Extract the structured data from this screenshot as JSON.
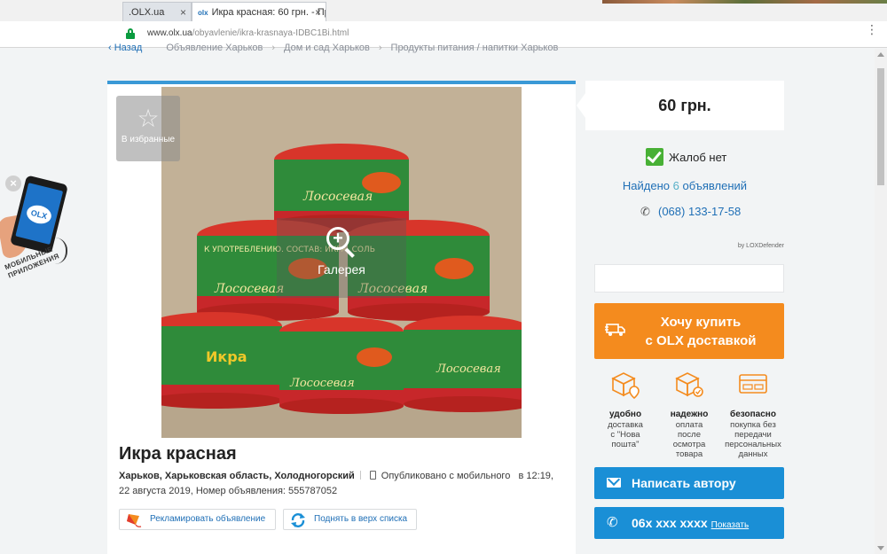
{
  "browser": {
    "tabs": [
      {
        "label": ".OLX.ua",
        "close": "×"
      },
      {
        "label": "Икра красная: 60 грн. - Пр",
        "close": "×",
        "favicon": "olx-favicon"
      }
    ],
    "url_host": "www.olx.ua",
    "url_path": "/obyavlenie/ikra-krasnaya-IDBC1Bi.html",
    "menu_icon": "⋮"
  },
  "breadcrumb": {
    "back": "Назад",
    "items": [
      "Объявление Харьков",
      "Дом и сад Харьков",
      "Продукты питания / напитки Харьков"
    ],
    "separator": "›"
  },
  "listing": {
    "favorite_label": "В избранные",
    "favorite_icon": "☆",
    "gallery_label": "Галерея",
    "title": "Икра красная",
    "location": "Харьков, Харьковская область, Холодногорский",
    "published": "Опубликовано с мобильного",
    "published_at": "в 12:19, 22 августа 2019, Номер объявления: 555787052",
    "promote_label": "Рекламировать объявление",
    "raise_label": "Поднять в верх списка",
    "photo_texts": {
      "can_label": "Лососевая",
      "lid_band": "К УПОТРЕБЛЕНИЮ. СОСТАВ: ИКРА, СОЛЬ",
      "side_text": "Икра"
    }
  },
  "promo": {
    "close": "×",
    "logo": "OLX",
    "line1": "МОБИЛЬНЫЕ",
    "line2": "ПРИЛОЖЕНИЯ"
  },
  "sidebar": {
    "price": "60 грн.",
    "complaints": "Жалоб нет",
    "found_prefix": "Найдено",
    "found_count": "6",
    "found_suffix": "объявлений",
    "phone": "(068) 133-17-58",
    "phone_icon": "✆",
    "defender": "by LOXDefender",
    "buy_line1": "Хочу купить",
    "buy_line2": "с OLX доставкой",
    "features": [
      {
        "title": "удобно",
        "lines": [
          "доставка",
          "с \"Нова",
          "пошта\""
        ]
      },
      {
        "title": "надежно",
        "lines": [
          "оплата",
          "после",
          "осмотра",
          "товара"
        ]
      },
      {
        "title": "безопасно",
        "lines": [
          "покупка без",
          "передачи",
          "персональных",
          "данных"
        ]
      }
    ],
    "write_label": "Написать автору",
    "phone_masked": "06х ххх хххх",
    "show_label": "Показать"
  },
  "colors": {
    "accent_blue": "#1a8fd6",
    "orange": "#f48b1e",
    "top_border": "#3a99d6",
    "check_green": "#48b035"
  }
}
